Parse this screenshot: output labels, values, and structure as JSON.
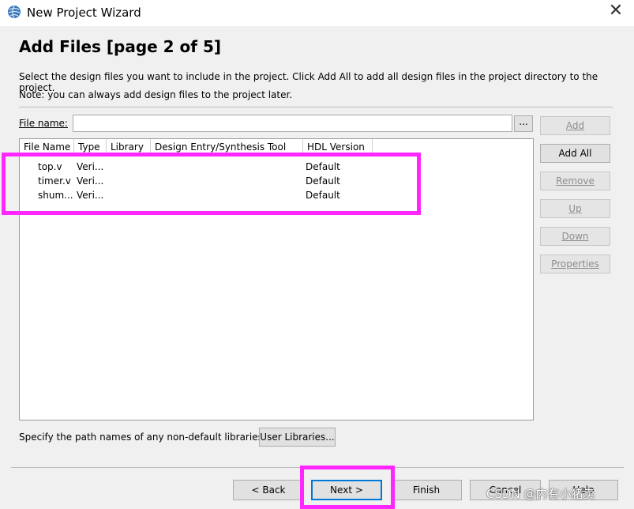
{
  "window": {
    "title": "New Project Wizard",
    "close_glyph": "✕"
  },
  "page": {
    "title": "Add Files [page 2 of 5]",
    "description": "Select the design files you want to include in the project. Click Add All to add all design files in the project directory to the project.",
    "note": "Note: you can always add design files to the project later."
  },
  "file_name": {
    "label": "File name:",
    "value": "",
    "browse_label": "..."
  },
  "table": {
    "columns": [
      "File Name",
      "Type",
      "Library",
      "Design Entry/Synthesis Tool",
      "HDL Version"
    ],
    "rows": [
      {
        "file": "top.v",
        "type": "Veri...",
        "library": "",
        "tool": "",
        "hdl": "Default"
      },
      {
        "file": "timer.v",
        "type": "Veri...",
        "library": "",
        "tool": "",
        "hdl": "Default"
      },
      {
        "file": "shum...",
        "type": "Veri...",
        "library": "",
        "tool": "",
        "hdl": "Default"
      }
    ]
  },
  "side_buttons": {
    "add": "Add",
    "add_all": "Add All",
    "remove": "Remove",
    "up": "Up",
    "down": "Down",
    "properties": "Properties"
  },
  "libraries": {
    "hint": "Specify the path names of any non-default libraries.",
    "button": "User Libraries..."
  },
  "footer": {
    "back": "< Back",
    "next": "Next >",
    "finish": "Finish",
    "cancel": "Cancel",
    "help": "Help"
  },
  "watermark": "CSDN @内有小猪卖",
  "colors": {
    "highlight": "#ff26ff",
    "dialog_bg": "#f0f0f0",
    "default_button_border": "#0078d7"
  }
}
